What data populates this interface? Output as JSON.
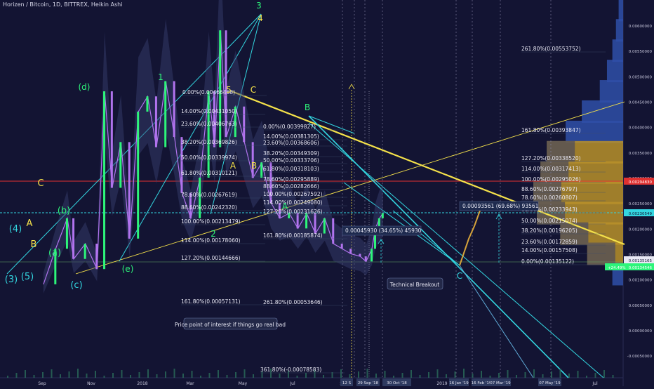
{
  "header": {
    "title": "Horizen / Bitcoin, 1D, BITTREX, Heikin Ashi"
  },
  "colors": {
    "background": "#131433",
    "green": "#2df57a",
    "purple": "#b173ee",
    "cyan": "#33d6e0",
    "yellow": "#f5e24a",
    "red": "#e03131",
    "volume_gold": "#b8902a",
    "volume_blue": "#2f4fa8",
    "volume_gray": "#4a4a5e"
  },
  "chart_data": {
    "type": "candlestick",
    "pair": "ZEN/BTC",
    "interval": "1D",
    "exchange": "BITTREX",
    "style": "Heikin Ashi",
    "yscale": "log",
    "ylim": [
      -0.0006,
      0.0068
    ],
    "ticks": {
      "y": [
        "0.00600000",
        "0.00550000",
        "0.00500000",
        "0.00450000",
        "0.00400000",
        "0.00350000",
        "0.00300000",
        "0.00250000",
        "0.00200000",
        "0.00150000",
        "0.00100000",
        "0.00050000",
        "0.00000000",
        "-0.00050000"
      ],
      "x": [
        "Sep",
        "Nov",
        "2018",
        "Mar",
        "May",
        "Jul",
        "Sep",
        "2019",
        "Mar",
        "May",
        "Jul"
      ],
      "x_highlights": [
        "12 S",
        "29 Sep '18",
        "30 Oct '18",
        "16 Jan '19",
        "16 Feb '19",
        "07 Mar '19",
        "07 May '19"
      ]
    },
    "price_markers": [
      {
        "label": "0.00294830",
        "color": "red"
      },
      {
        "label": "0.00230549",
        "color": "cyan"
      },
      {
        "label": "0.00135165",
        "color": "white"
      },
      {
        "label": "0.00134546",
        "change": "+24.49%",
        "color": "green"
      }
    ],
    "price_series": [
      {
        "date": "2017-07-15",
        "value": 0.0009
      },
      {
        "date": "2017-08-05",
        "value": 0.0016
      },
      {
        "date": "2017-08-25",
        "value": 0.0022
      },
      {
        "date": "2017-09-05",
        "value": 0.0014
      },
      {
        "date": "2017-09-25",
        "value": 0.0017
      },
      {
        "date": "2017-10-15",
        "value": 0.0012
      },
      {
        "date": "2017-10-28",
        "value": 0.0047
      },
      {
        "date": "2017-11-10",
        "value": 0.0028
      },
      {
        "date": "2017-11-25",
        "value": 0.0037
      },
      {
        "date": "2017-12-10",
        "value": 0.0018
      },
      {
        "date": "2017-12-25",
        "value": 0.0043
      },
      {
        "date": "2018-01-10",
        "value": 0.0046
      },
      {
        "date": "2018-01-25",
        "value": 0.0036
      },
      {
        "date": "2018-02-10",
        "value": 0.0049
      },
      {
        "date": "2018-02-25",
        "value": 0.0038
      },
      {
        "date": "2018-03-10",
        "value": 0.0027
      },
      {
        "date": "2018-03-25",
        "value": 0.0022
      },
      {
        "date": "2018-04-10",
        "value": 0.003
      },
      {
        "date": "2018-04-25",
        "value": 0.0047
      },
      {
        "date": "2018-05-05",
        "value": 0.0036
      },
      {
        "date": "2018-05-15",
        "value": 0.0059
      },
      {
        "date": "2018-05-25",
        "value": 0.0038
      },
      {
        "date": "2018-06-10",
        "value": 0.0044
      },
      {
        "date": "2018-06-25",
        "value": 0.0037
      },
      {
        "date": "2018-07-10",
        "value": 0.003
      },
      {
        "date": "2018-07-25",
        "value": 0.0033
      },
      {
        "date": "2018-08-10",
        "value": 0.0025
      },
      {
        "date": "2018-08-25",
        "value": 0.0022
      },
      {
        "date": "2018-09-10",
        "value": 0.0023
      },
      {
        "date": "2018-09-25",
        "value": 0.002
      },
      {
        "date": "2018-10-10",
        "value": 0.0023
      },
      {
        "date": "2018-10-25",
        "value": 0.0019
      },
      {
        "date": "2018-11-10",
        "value": 0.0022
      },
      {
        "date": "2018-11-25",
        "value": 0.0017
      },
      {
        "date": "2018-12-10",
        "value": 0.0016
      },
      {
        "date": "2018-12-25",
        "value": 0.0015
      },
      {
        "date": "2019-01-10",
        "value": 0.00145
      },
      {
        "date": "2019-01-20",
        "value": 0.00135
      },
      {
        "date": "2019-01-30",
        "value": 0.0016
      },
      {
        "date": "2019-02-05",
        "value": 0.002
      },
      {
        "date": "2019-02-12",
        "value": 0.0022
      },
      {
        "date": "2019-02-18",
        "value": 0.0023
      }
    ],
    "fib_levels": [
      {
        "label": "0.00%(0.00466468)",
        "value": 0.00466468
      },
      {
        "label": "14.00%(0.00431050)",
        "value": 0.0043105
      },
      {
        "label": "23.60%(0.00406763)",
        "value": 0.00406763
      },
      {
        "label": "38.20%(0.00369826)",
        "value": 0.00369826
      },
      {
        "label": "50.00%(0.00339974)",
        "value": 0.00339974
      },
      {
        "label": "61.80%(0.00310121)",
        "value": 0.00310121
      },
      {
        "label": "78.60%(0.00267619)",
        "value": 0.00267619
      },
      {
        "label": "88.60%(0.00242320)",
        "value": 0.0024232
      },
      {
        "label": "100.00%(0.00213479)",
        "value": 0.00213479
      },
      {
        "label": "114.00%(0.00178060)",
        "value": 0.0017806
      },
      {
        "label": "127.20%(0.00144666)",
        "value": 0.00144666
      },
      {
        "label": "161.80%(0.00057131)",
        "value": 0.00057131
      },
      {
        "label": "0.00%(0.00399827)",
        "value": 0.00399827
      },
      {
        "label": "14.00%(0.00381305)",
        "value": 0.00381305
      },
      {
        "label": "23.60%(0.00368606)",
        "value": 0.00368606
      },
      {
        "label": "38.20%(0.00349309)",
        "value": 0.00349309
      },
      {
        "label": "50.00%(0.00333706)",
        "value": 0.00333706
      },
      {
        "label": "61.80%(0.00318103)",
        "value": 0.00318103
      },
      {
        "label": "78.60%(0.00295889)",
        "value": 0.00295889
      },
      {
        "label": "88.60%(0.00282666)",
        "value": 0.00282666
      },
      {
        "label": "100.00%(0.00267592)",
        "value": 0.00267592
      },
      {
        "label": "114.00%(0.00249080)",
        "value": 0.0024908
      },
      {
        "label": "127.20%(0.00231626)",
        "value": 0.00231626
      },
      {
        "label": "161.80%(0.00185874)",
        "value": 0.00185874
      },
      {
        "label": "261.80%(0.00053646)",
        "value": 0.00053646
      },
      {
        "label": "361.80%(-0.00078583)",
        "value": -0.00078583
      },
      {
        "label": "261.80%(0.00553752)",
        "value": 0.00553752
      },
      {
        "label": "161.80%(0.00393847)",
        "value": 0.00393847
      },
      {
        "label": "127.20%(0.00338520)",
        "value": 0.0033852
      },
      {
        "label": "114.00%(0.00317413)",
        "value": 0.00317413
      },
      {
        "label": "100.00%(0.00295026)",
        "value": 0.00295026
      },
      {
        "label": "88.60%(0.00276797)",
        "value": 0.00276797
      },
      {
        "label": "78.60%(0.00260807)",
        "value": 0.00260807
      },
      {
        "label": "61.80%(0.00233943)",
        "value": 0.00233943
      },
      {
        "label": "50.00%(0.00215074)",
        "value": 0.00215074
      },
      {
        "label": "38.20%(0.00196205)",
        "value": 0.00196205
      },
      {
        "label": "23.60%(0.00172859)",
        "value": 0.00172859
      },
      {
        "label": "14.00%(0.00157508)",
        "value": 0.00157508
      },
      {
        "label": "0.00%(0.00135122)",
        "value": 0.00135122
      }
    ],
    "wave_labels": [
      "(3)",
      "(4)",
      "(5)",
      "A",
      "B",
      "C",
      "(a)",
      "(b)",
      "(c)",
      "(d)",
      "(e)",
      "1",
      "2",
      "3",
      "4",
      "5",
      "A",
      "B",
      "C",
      "A",
      "B",
      "C",
      "A",
      "B",
      "C"
    ],
    "measurements": [
      {
        "label": "0.00045930 (34.65%) 45930"
      },
      {
        "label": "0.00093561 (69.68%) 93561"
      }
    ],
    "annotations": [
      {
        "label": "Technical Breakout"
      },
      {
        "label": "Price point of interest if things go real bad"
      }
    ],
    "volume_profile": [
      {
        "price": 0.0063,
        "volume": 5
      },
      {
        "price": 0.0059,
        "volume": 8
      },
      {
        "price": 0.0055,
        "volume": 12
      },
      {
        "price": 0.0051,
        "volume": 18
      },
      {
        "price": 0.0047,
        "volume": 26
      },
      {
        "price": 0.0043,
        "volume": 46
      },
      {
        "price": 0.0039,
        "volume": 64
      },
      {
        "price": 0.0035,
        "volume": 85
      },
      {
        "price": 0.0031,
        "volume": 92
      },
      {
        "price": 0.0027,
        "volume": 100
      },
      {
        "price": 0.0023,
        "volume": 96
      },
      {
        "price": 0.0019,
        "volume": 70
      },
      {
        "price": 0.0015,
        "volume": 40
      },
      {
        "price": 0.0011,
        "volume": 12
      }
    ]
  }
}
